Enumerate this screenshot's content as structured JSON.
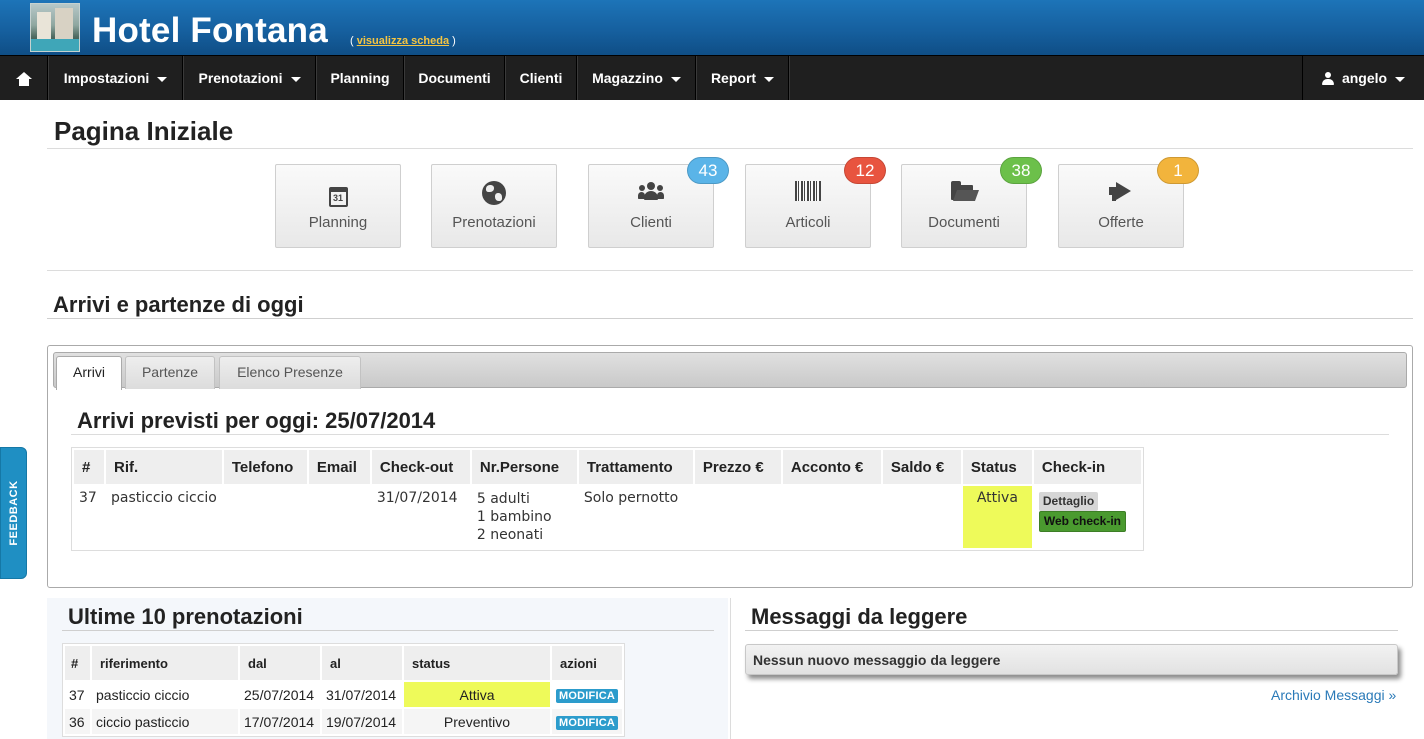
{
  "header": {
    "title": "Hotel Fontana",
    "link_open": "(",
    "link_text": "visualizza scheda",
    "link_close": ")"
  },
  "nav": {
    "home_icon": "home-icon",
    "items": [
      {
        "label": "Impostazioni",
        "dropdown": true
      },
      {
        "label": "Prenotazioni",
        "dropdown": true
      },
      {
        "label": "Planning",
        "dropdown": false
      },
      {
        "label": "Documenti",
        "dropdown": false
      },
      {
        "label": "Clienti",
        "dropdown": false
      },
      {
        "label": "Magazzino",
        "dropdown": true
      },
      {
        "label": "Report",
        "dropdown": true
      }
    ],
    "user": "angelo"
  },
  "page_title": "Pagina Iniziale",
  "tiles": [
    {
      "label": "Planning",
      "icon": "calendar-icon",
      "glyph": "31",
      "badge": null
    },
    {
      "label": "Prenotazioni",
      "icon": "globe-icon",
      "glyph": "🌍",
      "badge": null
    },
    {
      "label": "Clienti",
      "icon": "users-icon",
      "glyph": "👥",
      "badge": "43",
      "badge_color": "#5ab4e8"
    },
    {
      "label": "Articoli",
      "icon": "barcode-icon",
      "glyph": "▌▌▌",
      "badge": "12",
      "badge_color": "#e8543f"
    },
    {
      "label": "Documenti",
      "icon": "folder-open-icon",
      "glyph": "📂",
      "badge": "38",
      "badge_color": "#6cc04a"
    },
    {
      "label": "Offerte",
      "icon": "megaphone-icon",
      "glyph": "📢",
      "badge": "1",
      "badge_color": "#f2b43c"
    }
  ],
  "arrivals_section": {
    "title": "Arrivi e partenze di oggi",
    "tabs": [
      "Arrivi",
      "Partenze",
      "Elenco Presenze"
    ],
    "subtitle": "Arrivi previsti per oggi: 25/07/2014",
    "columns": [
      "#",
      "Rif.",
      "Telefono",
      "Email",
      "Check-out",
      "Nr.Persone",
      "Trattamento",
      "Prezzo €",
      "Acconto €",
      "Saldo €",
      "Status",
      "Check-in"
    ],
    "rows": [
      {
        "num": "37",
        "rif": "pasticcio ciccio",
        "telefono": "",
        "email": "",
        "checkout": "31/07/2014",
        "persone": [
          "5 adulti",
          "1 bambino",
          "2 neonati"
        ],
        "trattamento": "Solo pernotto",
        "prezzo": "",
        "acconto": "",
        "saldo": "",
        "status": "Attiva",
        "actions": [
          "Dettaglio",
          "Web check-in"
        ]
      }
    ]
  },
  "bookings": {
    "title": "Ultime 10 prenotazioni",
    "columns": [
      "#",
      "riferimento",
      "dal",
      "al",
      "status",
      "azioni"
    ],
    "rows": [
      {
        "num": "37",
        "rif": "pasticcio ciccio",
        "dal": "25/07/2014",
        "al": "31/07/2014",
        "status": "Attiva",
        "status_color": "#eefa5a",
        "action": "MODIFICA"
      },
      {
        "num": "36",
        "rif": "ciccio pasticcio",
        "dal": "17/07/2014",
        "al": "19/07/2014",
        "status": "Preventivo",
        "status_color": "#eebc7a",
        "action": "MODIFICA"
      }
    ]
  },
  "messages": {
    "title": "Messaggi da leggere",
    "empty": "Nessun nuovo messaggio da leggere",
    "archive_link": "Archivio Messaggi »"
  },
  "feedback": "FEEDBACK"
}
